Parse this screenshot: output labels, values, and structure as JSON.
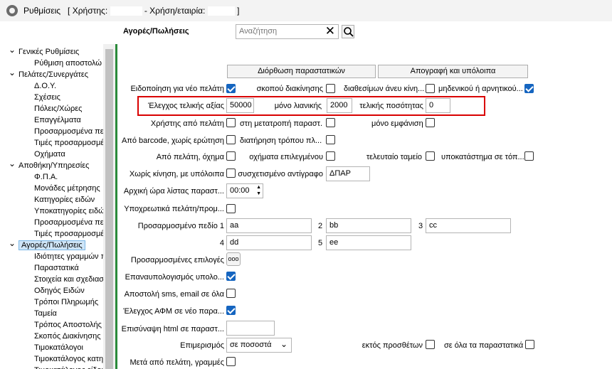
{
  "window": {
    "title_prefix": "Ρυθμίσεις",
    "user_label": "[ Χρήστης:",
    "company_label": "- Χρήση/εταιρία:",
    "close_bracket": "]"
  },
  "section_title": "Αγορές/Πωλήσεις",
  "search": {
    "placeholder": "Αναζήτηση"
  },
  "tree": [
    {
      "label": "Γενικές Ρυθμίσεις",
      "level": 0,
      "expanded": true
    },
    {
      "label": "Ρύθμιση αποστολώ",
      "level": 1
    },
    {
      "label": "Πελάτες/Συνεργάτες",
      "level": 0,
      "expanded": true
    },
    {
      "label": "Δ.Ο.Υ.",
      "level": 1
    },
    {
      "label": "Σχέσεις",
      "level": 1
    },
    {
      "label": "Πόλεις/Χώρες",
      "level": 1
    },
    {
      "label": "Επαγγέλματα",
      "level": 1
    },
    {
      "label": "Προσαρμοσμένα πε",
      "level": 1
    },
    {
      "label": "Τιμές προσαρμοσμέ",
      "level": 1
    },
    {
      "label": "Οχήματα",
      "level": 1
    },
    {
      "label": "Αποθήκη/Υπηρεσίες",
      "level": 0,
      "expanded": true
    },
    {
      "label": "Φ.Π.Α.",
      "level": 1
    },
    {
      "label": "Μονάδες μέτρησης",
      "level": 1
    },
    {
      "label": "Κατηγορίες ειδών",
      "level": 1
    },
    {
      "label": "Υποκατηγορίες ειδώ",
      "level": 1
    },
    {
      "label": "Προσαρμοσμένα πε",
      "level": 1
    },
    {
      "label": "Τιμές προσαρμοσμέ",
      "level": 1
    },
    {
      "label": "Αγορές/Πωλήσεις",
      "level": 0,
      "expanded": true,
      "selected": true
    },
    {
      "label": "Ιδιότητες γραμμών π",
      "level": 1
    },
    {
      "label": "Παραστατικά",
      "level": 1
    },
    {
      "label": "Στοιχεία και σχεδιασ",
      "level": 1
    },
    {
      "label": "Οδηγός Ειδών",
      "level": 1
    },
    {
      "label": "Τρόποι Πληρωμής",
      "level": 1
    },
    {
      "label": "Ταμεία",
      "level": 1
    },
    {
      "label": "Τρόπος Αποστολής",
      "level": 1
    },
    {
      "label": "Σκοπός Διακίνησης",
      "level": 1
    },
    {
      "label": "Τιμοκατάλογοι",
      "level": 1
    },
    {
      "label": "Τιμοκατάλογος κατη",
      "level": 1
    },
    {
      "label": "Τιμοκατάλογος είδου",
      "level": 1
    }
  ],
  "buttons": {
    "fix_docs": "Διόρθωση παραστατικών",
    "inventory": "Απογραφή και υπόλοιπα"
  },
  "form": {
    "notify_new_customer": "Ειδοποίηση για νέο πελάτη",
    "shipping_purpose": "σκοπού διακίνησης",
    "available_without_move": "διαθεσίμων άνευ κίνη...",
    "zero_or_negative": "μηδενικού ή αρνητικού...",
    "final_value_check": "Έλεγχος τελικής αξίας",
    "final_value": "50000",
    "retail_only": "μόνο λιανικής",
    "retail_value": "2000",
    "final_quantity": "τελικής ποσότητας",
    "quantity_value": "0",
    "from_customer": "Χρήστης από πελάτη",
    "no_conversion": "στη μετατροπή παραστ.",
    "only_display": "μόνο εμφάνιση",
    "from_barcode": "Από barcode, χωρίς ερώτηση",
    "keep_method": "διατήρηση τρόπου πλ...",
    "from_customer_vehicle": "Από πελάτη, όχημα",
    "selected_vehicles": "οχήματα επιλεγμένου",
    "last_register": "τελευταίο ταμείο",
    "branch_all": "υποκατάστημα σε τόπ...",
    "no_movement_balance": "Χωρίς κίνηση, με υπόλοιπα",
    "linked_copy": "συσχετισμένο αντίγραφο",
    "linked_copy_value": "ΔΠΑΡ",
    "list_start_time": "Αρχική ώρα λίστας παραστ...",
    "list_start_value": "00:00",
    "mandatory_customer": "Υποχρεωτικά πελάτη/προμ...",
    "custom_field": "Προσαρμοσμένο πεδίο 1",
    "field1": "aa",
    "label2": "2",
    "field2": "bb",
    "label3": "3",
    "field3": "cc",
    "label4": "4",
    "field4": "dd",
    "label5": "5",
    "field5": "ee",
    "custom_options": "Προσαρμοσμένες επιλογές",
    "custom_options_btn": "ooo",
    "recalc": "Επαναυπολογισμός υπολο...",
    "send_sms": "Αποστολή sms, email σε όλα",
    "afm_check": "Έλεγχος ΑΦΜ σε νέο παρα...",
    "attach_html": "Επισύναψη html σε παραστ...",
    "allocation": "Επιμερισμός",
    "allocation_value": "σε ποσοστά",
    "except_extras": "εκτός προσθέτων",
    "all_docs": "σε όλα τα παραστατικά",
    "after_customer_lines": "Μετά από πελάτη, γραμμές"
  }
}
